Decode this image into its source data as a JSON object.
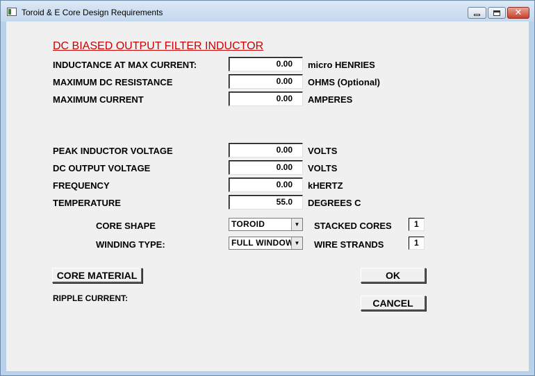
{
  "window": {
    "title": "Toroid & E Core Design Requirements",
    "controls": {
      "minimize": "minimize",
      "maximize": "maximize",
      "close": "✕"
    }
  },
  "heading": "DC BIASED OUTPUT FILTER INDUCTOR",
  "fields": [
    {
      "label": "INDUCTANCE AT MAX CURRENT:",
      "value": "0.00",
      "unit": "micro HENRIES"
    },
    {
      "label": "MAXIMUM DC RESISTANCE",
      "value": "0.00",
      "unit": "OHMS (Optional)"
    },
    {
      "label": "MAXIMUM CURRENT",
      "value": "0.00",
      "unit": "AMPERES"
    },
    {
      "label": "PEAK INDUCTOR VOLTAGE",
      "value": "0.00",
      "unit": "VOLTS"
    },
    {
      "label": "DC OUTPUT VOLTAGE",
      "value": "0.00",
      "unit": "VOLTS"
    },
    {
      "label": "FREQUENCY",
      "value": "0.00",
      "unit": "kHERTZ"
    },
    {
      "label": "TEMPERATURE",
      "value": "55.0",
      "unit": "DEGREES C"
    }
  ],
  "core_shape": {
    "label": "CORE SHAPE",
    "selected": "TOROID"
  },
  "winding_type": {
    "label": "WINDING TYPE:",
    "selected": "FULL WINDOW"
  },
  "stacked_cores": {
    "label": "STACKED CORES",
    "value": "1"
  },
  "wire_strands": {
    "label": "WIRE STRANDS",
    "value": "1"
  },
  "buttons": {
    "core_material": "CORE MATERIAL",
    "ok": "OK",
    "cancel": "CANCEL"
  },
  "ripple_current": {
    "label": "RIPPLE CURRENT:"
  },
  "icons": {
    "app": "app-icon",
    "dropdown": "chevron-down-icon"
  }
}
